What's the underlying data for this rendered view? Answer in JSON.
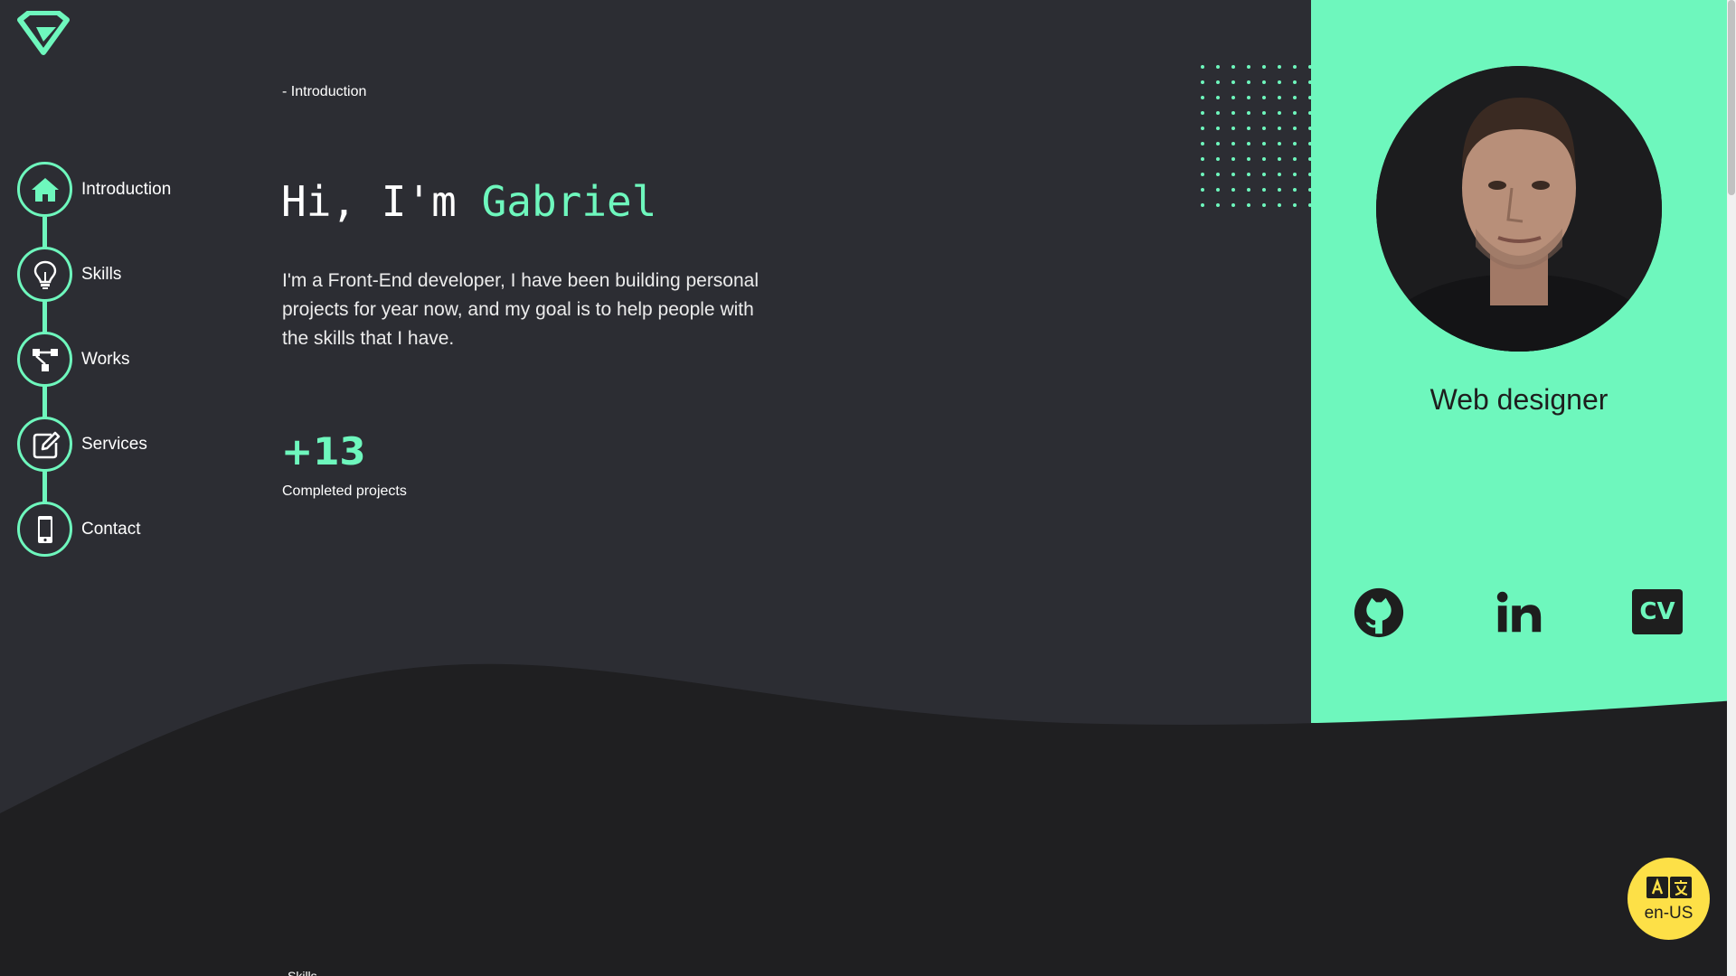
{
  "nav": {
    "items": [
      {
        "label": "Introduction",
        "icon": "home-icon"
      },
      {
        "label": "Skills",
        "icon": "lightbulb-icon"
      },
      {
        "label": "Works",
        "icon": "network-icon"
      },
      {
        "label": "Services",
        "icon": "edit-icon"
      },
      {
        "label": "Contact",
        "icon": "phone-icon"
      }
    ]
  },
  "hero": {
    "breadcrumb": "- Introduction",
    "title_prefix": "Hi, I'm ",
    "title_name": "Gabriel",
    "description": "I'm a Front-End developer, I have been building personal projects for year now, and my goal is to help people with the skills that I have.",
    "stat_value": "+13",
    "stat_label": "Completed projects"
  },
  "profile": {
    "role": "Web designer",
    "social": [
      {
        "name": "github-icon"
      },
      {
        "name": "linkedin-icon"
      }
    ],
    "cv_label": "CV"
  },
  "next_section_label": "Skills",
  "lang": {
    "label": "en-US",
    "icon": "translate-icon"
  },
  "colors": {
    "background": "#2c2d33",
    "accent": "#6ef7bd",
    "dark": "#1e1e1e",
    "lang_button": "#fde047"
  }
}
